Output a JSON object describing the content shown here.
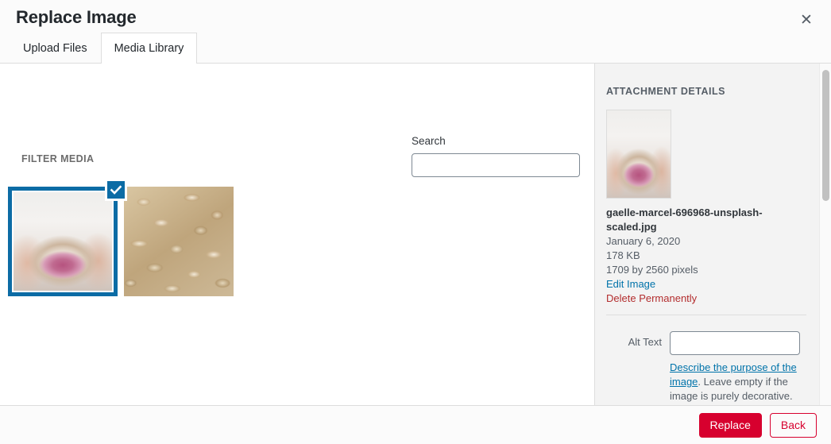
{
  "header": {
    "title": "Replace Image",
    "close_icon": "close-icon",
    "tabs": [
      {
        "label": "Upload Files",
        "active": false
      },
      {
        "label": "Media Library",
        "active": true
      }
    ]
  },
  "content": {
    "filter_label": "FILTER MEDIA",
    "search": {
      "label": "Search",
      "value": "",
      "placeholder": ""
    },
    "media_items": [
      {
        "name": "media-thumbnail-bowl",
        "selected": true,
        "check_icon": "checkmark-icon"
      },
      {
        "name": "media-thumbnail-oats",
        "selected": false
      }
    ]
  },
  "sidebar": {
    "heading": "ATTACHMENT DETAILS",
    "thumbnail_name": "attachment-thumbnail",
    "filename": "gaelle-marcel-696968-unsplash-scaled.jpg",
    "date": "January 6, 2020",
    "filesize": "178 KB",
    "dimensions": "1709 by 2560 pixels",
    "edit_link": "Edit Image",
    "delete_link": "Delete Permanently",
    "alt_text": {
      "label": "Alt Text",
      "value": "",
      "placeholder": "",
      "help_link": "Describe the purpose of the",
      "help_link_cont": "image",
      "help_rest": ". Leave empty if the image is purely decorative."
    }
  },
  "footer": {
    "replace_label": "Replace",
    "back_label": "Back"
  },
  "colors": {
    "accent_red": "#d7002e",
    "selection_blue": "#0c6ca5",
    "link_blue": "#0073aa",
    "delete_red": "#b32d2e"
  }
}
